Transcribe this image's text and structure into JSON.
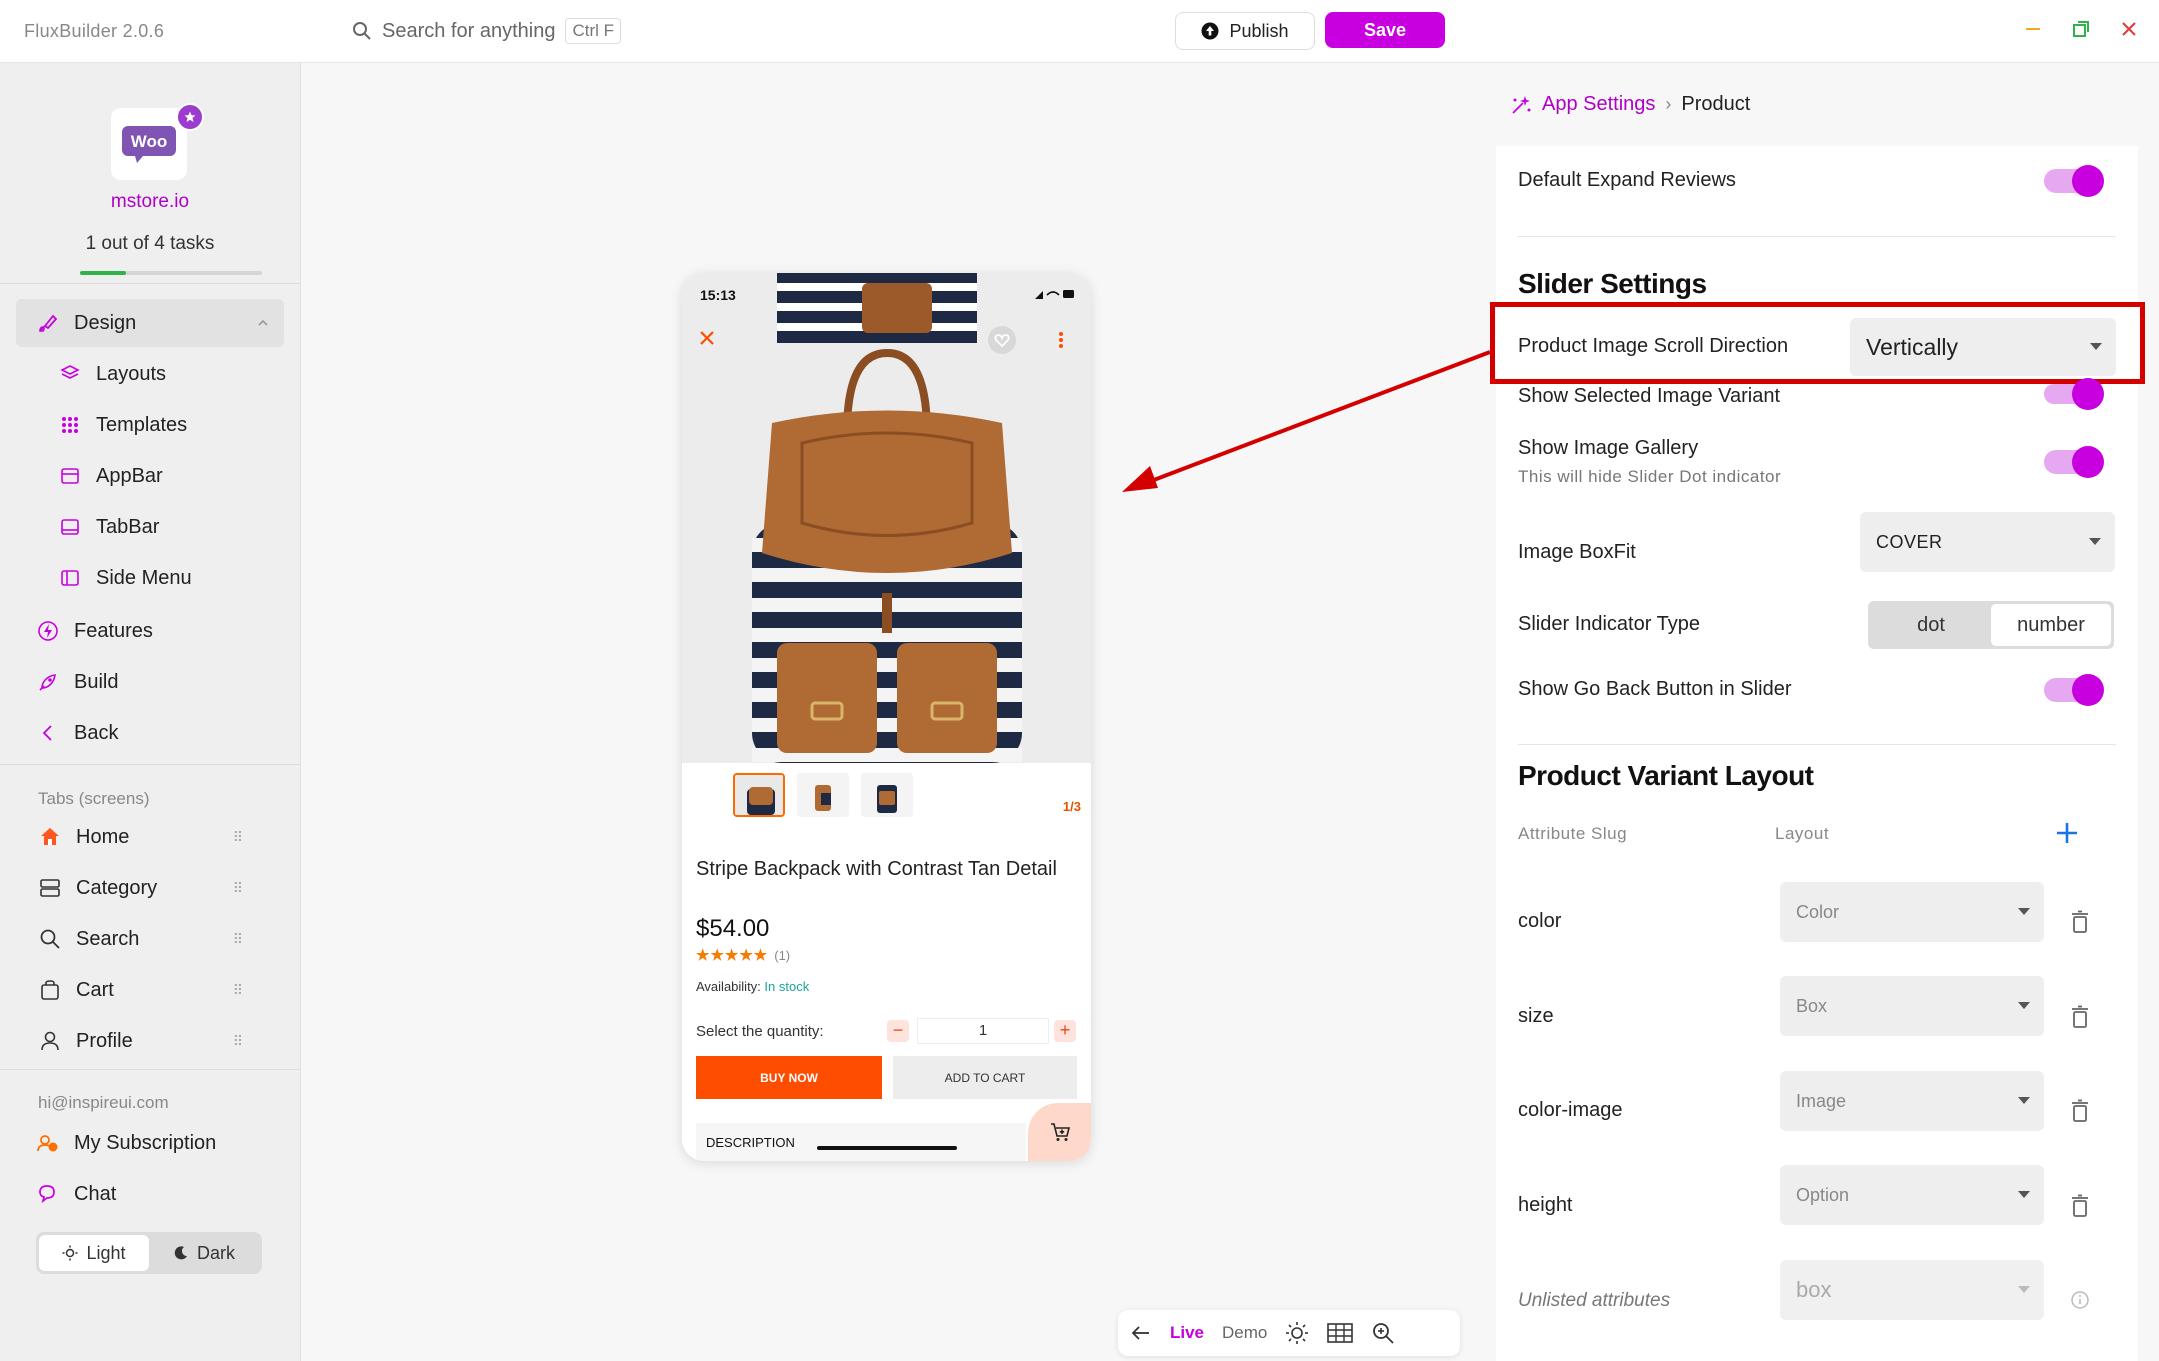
{
  "titlebar": {
    "app_title": "FluxBuilder 2.0.6",
    "search_placeholder": "Search for anything",
    "search_shortcut": "Ctrl F",
    "publish_label": "Publish",
    "save_label": "Save"
  },
  "sidebar": {
    "logo_text": "Woo",
    "store_name": "mstore.io",
    "tasks_text": "1 out of 4 tasks",
    "tasks_progress": 0.25,
    "design": {
      "label": "Design",
      "children": [
        "Layouts",
        "Templates",
        "AppBar",
        "TabBar",
        "Side Menu"
      ]
    },
    "features_label": "Features",
    "build_label": "Build",
    "back_label": "Back",
    "tabs_section_label": "Tabs (screens)",
    "tabs": [
      "Home",
      "Category",
      "Search",
      "Cart",
      "Profile"
    ],
    "email": "hi@inspireui.com",
    "subscription_label": "My Subscription",
    "chat_label": "Chat",
    "theme": {
      "light": "Light",
      "dark": "Dark",
      "selected": "Light"
    }
  },
  "phone": {
    "time": "15:13",
    "image_counter": "1/3",
    "product_title": "Stripe Backpack with Contrast Tan Detail",
    "price": "$54.00",
    "stars": "★★★★★",
    "review_count": "(1)",
    "availability_label": "Availability:",
    "availability_value": "In stock",
    "quantity_label": "Select the quantity:",
    "quantity_value": "1",
    "buy_now": "BUY NOW",
    "add_to_cart": "ADD TO CART",
    "description_tab": "DESCRIPTION"
  },
  "preview_bar": {
    "live": "Live",
    "demo": "Demo"
  },
  "settings": {
    "breadcrumb_root": "App Settings",
    "breadcrumb_current": "Product",
    "default_expand_reviews": "Default Expand Reviews",
    "slider_settings_heading": "Slider Settings",
    "scroll_direction_label": "Product Image Scroll Direction",
    "scroll_direction_value": "Vertically",
    "show_selected_variant": "Show Selected Image Variant",
    "show_image_gallery": "Show Image Gallery",
    "show_image_gallery_sub": "This will hide Slider Dot indicator",
    "image_boxfit_label": "Image BoxFit",
    "image_boxfit_value": "COVER",
    "slider_indicator_label": "Slider Indicator Type",
    "slider_indicator_options": [
      "dot",
      "number"
    ],
    "slider_indicator_selected": "number",
    "show_go_back": "Show Go Back Button in Slider",
    "variant_layout_heading": "Product Variant Layout",
    "col_attribute_slug": "Attribute Slug",
    "col_layout": "Layout",
    "variants": [
      {
        "slug": "color",
        "layout": "Color"
      },
      {
        "slug": "size",
        "layout": "Box"
      },
      {
        "slug": "color-image",
        "layout": "Image"
      },
      {
        "slug": "height",
        "layout": "Option"
      }
    ],
    "unlisted_label": "Unlisted attributes",
    "unlisted_value": "box"
  },
  "colors": {
    "accent": "#c800e0",
    "highlight_border": "#d40000",
    "buy_now": "#ff4d00",
    "progress": "#2fb34a"
  }
}
